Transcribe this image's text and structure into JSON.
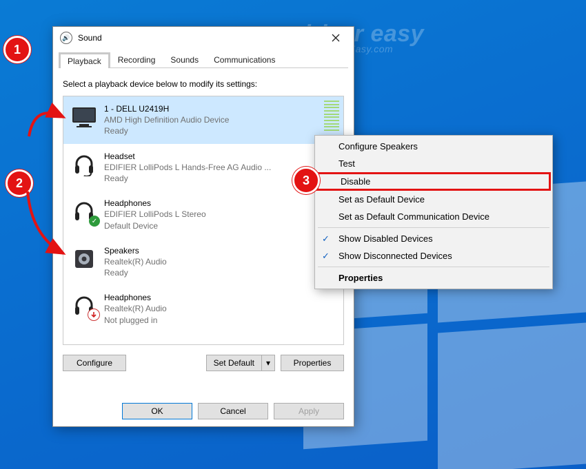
{
  "window": {
    "title": "Sound"
  },
  "tabs": [
    "Playback",
    "Recording",
    "Sounds",
    "Communications"
  ],
  "instruction": "Select a playback device below to modify its settings:",
  "devices": [
    {
      "name": "1 - DELL U2419H",
      "sub": "AMD High Definition Audio Device",
      "status": "Ready"
    },
    {
      "name": "Headset",
      "sub": "EDIFIER LolliPods L Hands-Free AG Audio ...",
      "status": "Ready"
    },
    {
      "name": "Headphones",
      "sub": "EDIFIER LolliPods L Stereo",
      "status": "Default Device"
    },
    {
      "name": "Speakers",
      "sub": "Realtek(R) Audio",
      "status": "Ready"
    },
    {
      "name": "Headphones",
      "sub": "Realtek(R) Audio",
      "status": "Not plugged in"
    }
  ],
  "buttons": {
    "configure": "Configure",
    "setdefault": "Set Default",
    "properties": "Properties",
    "ok": "OK",
    "cancel": "Cancel",
    "apply": "Apply"
  },
  "context_menu": [
    "Configure Speakers",
    "Test",
    "Disable",
    "Set as Default Device",
    "Set as Default Communication Device",
    "Show Disabled Devices",
    "Show Disconnected Devices",
    "Properties"
  ],
  "annotations": {
    "n1": "1",
    "n2": "2",
    "n3": "3"
  }
}
